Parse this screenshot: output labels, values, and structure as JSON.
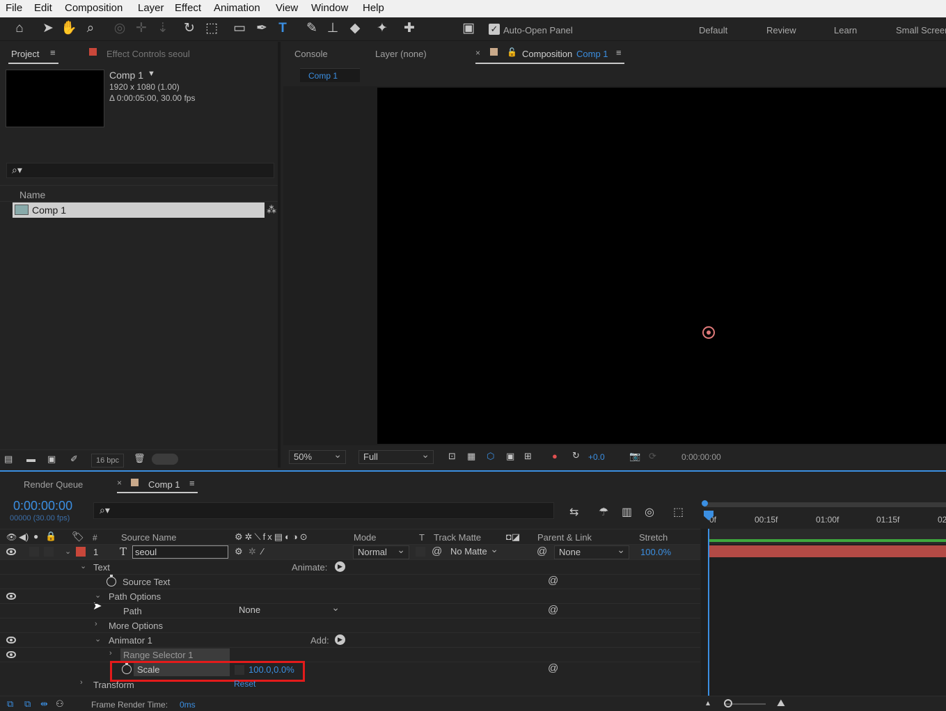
{
  "menu": [
    "File",
    "Edit",
    "Composition",
    "Layer",
    "Effect",
    "Animation",
    "View",
    "Window",
    "Help"
  ],
  "toolbar": {
    "auto_open_label": "Auto-Open Panel",
    "workspaces": [
      "Default",
      "Review",
      "Learn",
      "Small Screen"
    ]
  },
  "project_panel": {
    "tab_project": "Project",
    "tab_effect_controls": "Effect Controls seoul",
    "comp_name": "Comp 1",
    "comp_info1": "1920 x 1080 (1.00)",
    "comp_info2": "Δ 0:00:05:00, 30.00 fps",
    "col_name": "Name",
    "item": "Comp 1",
    "bpc": "16 bpc"
  },
  "viewer": {
    "tab_console": "Console",
    "tab_layer": "Layer (none)",
    "tab_comp_prefix": "Composition",
    "tab_comp_name": "Comp 1",
    "subtab": "Comp 1",
    "zoom": "50%",
    "resolution": "Full",
    "exposure": "+0.0",
    "timecode": "0:00:00:00"
  },
  "timeline": {
    "tab_render": "Render Queue",
    "tab_comp": "Comp 1",
    "timecode": "0:00:00:00",
    "frames": "00000 (30.00 fps)",
    "ruler": [
      "0f",
      "00:15f",
      "01:00f",
      "01:15f",
      "02"
    ],
    "cols": {
      "num": "#",
      "source": "Source Name",
      "mode": "Mode",
      "t": "T",
      "track_matte": "Track Matte",
      "parent": "Parent & Link",
      "stretch": "Stretch"
    },
    "layer": {
      "num": "1",
      "name": "seoul",
      "mode": "Normal",
      "matte": "No Matte",
      "parent": "None",
      "stretch": "100.0%"
    },
    "props": {
      "text": "Text",
      "animate": "Animate:",
      "source_text": "Source Text",
      "path_options": "Path Options",
      "path": "Path",
      "path_value": "None",
      "more_options": "More Options",
      "animator": "Animator 1",
      "add": "Add:",
      "range_selector": "Range Selector 1",
      "scale": "Scale",
      "scale_value": "100.0,0.0%",
      "transform": "Transform",
      "reset": "Reset"
    },
    "footer_label": "Frame Render Time:",
    "footer_value": "0ms"
  },
  "colors": {
    "accent": "#3b8fe2",
    "highlight": "#e31b1b",
    "layer_label": "#c9473a",
    "layer_bar": "#b34a45"
  }
}
